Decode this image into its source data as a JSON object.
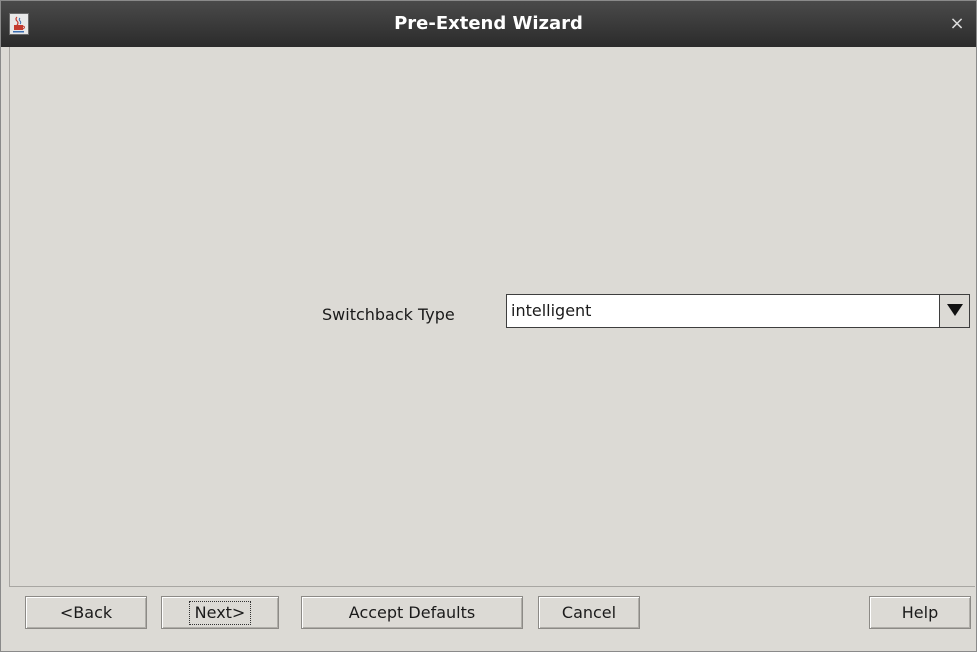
{
  "window": {
    "title": "Pre-Extend Wizard",
    "close_glyph": "×",
    "app_icon": "java-cup-icon"
  },
  "form": {
    "switchback_label": "Switchback Type",
    "switchback_value": "intelligent"
  },
  "buttons": {
    "back": "<Back",
    "next": "Next>",
    "accept_defaults": "Accept Defaults",
    "cancel": "Cancel",
    "help": "Help"
  }
}
